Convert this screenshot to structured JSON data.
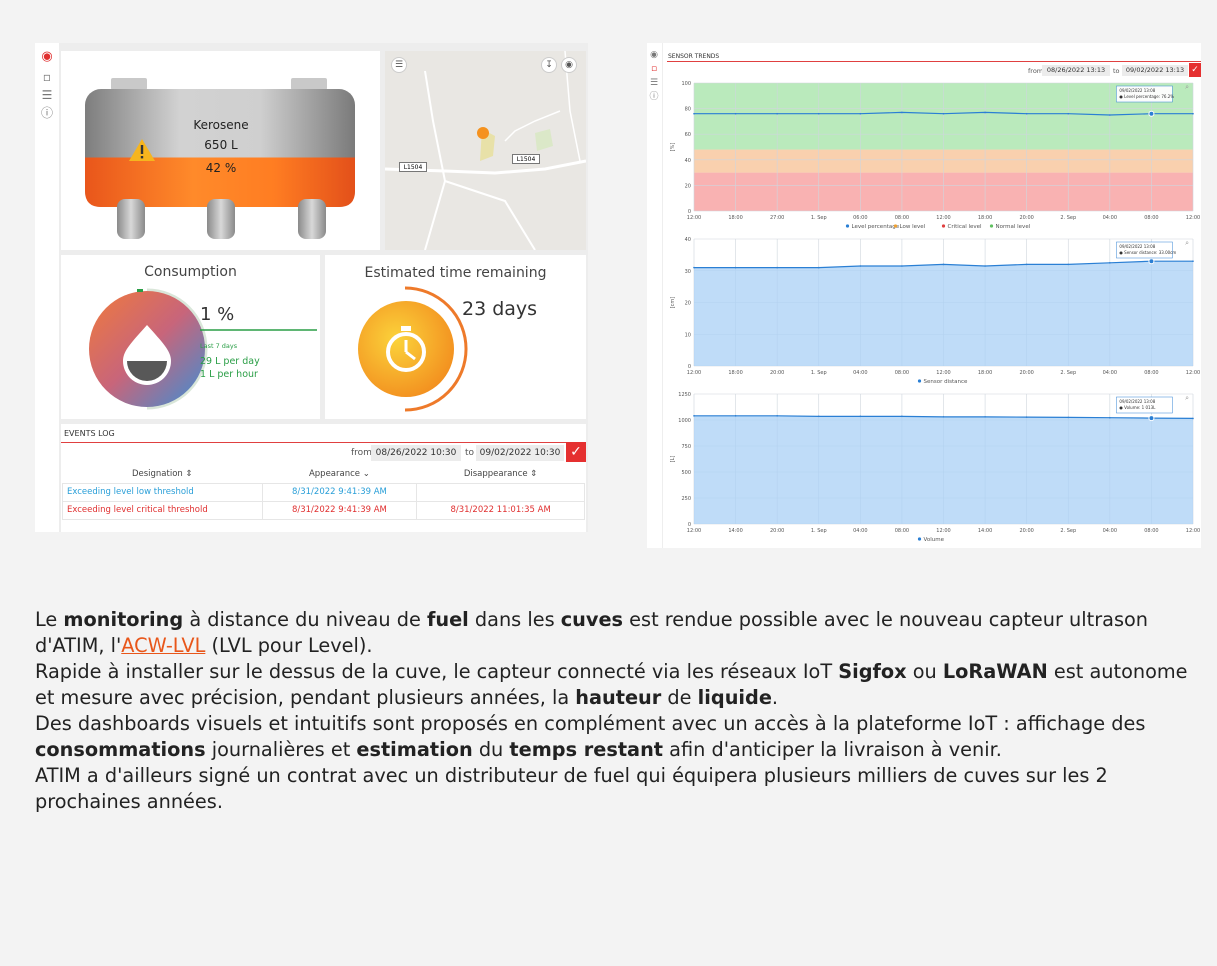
{
  "left_dashboard": {
    "rail": {
      "icons": [
        "alarm-icon",
        "bar-chart-icon",
        "settings-sliders-icon",
        "info-icon"
      ]
    },
    "tank": {
      "product": "Kerosene",
      "volume": "650 L",
      "level": "42 %",
      "level_fraction": 0.42,
      "warning": true
    },
    "map": {
      "road_labels": [
        "L1504",
        "L1504"
      ],
      "menu_icon": "menu-icon",
      "download_icon": "download-icon",
      "view_icon": "eye-icon"
    },
    "consumption": {
      "title": "Consumption",
      "percent": "1 %",
      "period": "Last 7 days",
      "per_day": "29 L per day",
      "per_hour": "1 L per hour"
    },
    "estimated_time": {
      "title": "Estimated time remaining",
      "value": "23 days"
    },
    "events_log": {
      "title": "EVENTS LOG",
      "from_label": "from",
      "from_value": "08/26/2022 10:30",
      "to_label": "to",
      "to_value": "09/02/2022 10:30",
      "columns": [
        "Designation ⇕",
        "Appearance ⌄",
        "Disappearance ⇕"
      ],
      "rows": [
        {
          "designation": "Exceeding level low threshold",
          "appearance": "8/31/2022 9:41:39 AM",
          "disappearance": "",
          "color": "#2a9fd8"
        },
        {
          "designation": "Exceeding level critical threshold",
          "appearance": "8/31/2022 9:41:39 AM",
          "disappearance": "8/31/2022 11:01:35 AM",
          "color": "#e03030"
        }
      ]
    }
  },
  "right_dashboard": {
    "title": "SENSOR TRENDS",
    "from_label": "from",
    "from_value": "08/26/2022 13:13",
    "to_label": "to",
    "to_value": "09/02/2022 13:13"
  },
  "chart_data": [
    {
      "type": "line",
      "ylabel": "[%]",
      "ylim": [
        0,
        100
      ],
      "yticks": [
        "0",
        "20",
        "40",
        "60",
        "80",
        "100"
      ],
      "x": [
        "12:00",
        "18:00",
        "27:00",
        "1. Sep",
        "06:00",
        "08:00",
        "12:00",
        "18:00",
        "20:00",
        "2. Sep",
        "04:00",
        "08:00",
        "12:00"
      ],
      "series": [
        {
          "name": "Level percentage",
          "values": [
            76,
            76,
            76,
            76,
            76,
            77,
            76,
            77,
            76,
            76,
            75,
            76,
            76
          ]
        }
      ],
      "bands": [
        {
          "name": "Critical level",
          "from": 0,
          "to": 30,
          "color": "#f8a5a5"
        },
        {
          "name": "Low level",
          "from": 30,
          "to": 48,
          "color": "#f8c8a0"
        },
        {
          "name": "Normal level",
          "from": 48,
          "to": 100,
          "color": "#aee6b0"
        }
      ],
      "legend": [
        "Level percentage",
        "Low level",
        "Critical level",
        "Normal level"
      ],
      "legend_colors": [
        "#2a7fd4",
        "#f0a030",
        "#e04040",
        "#60c060"
      ],
      "tooltip": [
        "09/02/2022 13:08",
        "● Level percentage: 76.2%"
      ]
    },
    {
      "type": "area",
      "ylabel": "[cm]",
      "ylim": [
        0,
        40
      ],
      "yticks": [
        "0",
        "10",
        "20",
        "30",
        "40"
      ],
      "x": [
        "12:00",
        "18:00",
        "20:00",
        "1. Sep",
        "04:00",
        "08:00",
        "12:00",
        "18:00",
        "20:00",
        "2. Sep",
        "04:00",
        "08:00",
        "12:00"
      ],
      "series": [
        {
          "name": "Sensor distance",
          "values": [
            31,
            31,
            31,
            31,
            31.5,
            31.5,
            32,
            31.5,
            32,
            32,
            32.5,
            33,
            33
          ]
        }
      ],
      "legend": [
        "Sensor distance"
      ],
      "tooltip": [
        "09/02/2022 13:08",
        "● Sensor distance: 33.00cm"
      ]
    },
    {
      "type": "area",
      "ylabel": "[L]",
      "ylim": [
        0,
        1250
      ],
      "yticks": [
        "0",
        "250",
        "500",
        "750",
        "1000",
        "1250"
      ],
      "x": [
        "12:00",
        "14:00",
        "20:00",
        "1. Sep",
        "04:00",
        "08:00",
        "12:00",
        "14:00",
        "20:00",
        "2. Sep",
        "04:00",
        "08:00",
        "12:00"
      ],
      "series": [
        {
          "name": "Volume",
          "values": [
            1040,
            1040,
            1040,
            1035,
            1035,
            1035,
            1030,
            1030,
            1028,
            1025,
            1022,
            1018,
            1015
          ]
        }
      ],
      "legend": [
        "Volume"
      ],
      "tooltip": [
        "09/02/2022 13:08",
        "● Volume: 1 013L"
      ]
    }
  ],
  "article": {
    "p1_a": "Le ",
    "p1_b": "monitoring",
    "p1_c": " à distance du niveau de ",
    "p1_d": "fuel",
    "p1_e": " dans les ",
    "p1_f": "cuves",
    "p1_g": " est rendue possible avec le nouveau capteur ultrason d'ATIM, l'",
    "p1_link": "ACW-LVL",
    "p1_h": " (LVL pour Level).",
    "p2_a": "Rapide à installer sur le dessus de la cuve, le capteur connecté via les réseaux IoT ",
    "p2_b": "Sigfox",
    "p2_c": " ou ",
    "p2_d": "LoRaWAN",
    "p2_e": " est autonome et mesure avec précision, pendant plusieurs années, la ",
    "p2_f": "hauteur",
    "p2_g": " de ",
    "p2_h": "liquide",
    "p2_i": ".",
    "p3_a": "Des dashboards visuels et intuitifs sont proposés en complément avec un accès à la plateforme IoT : affichage des ",
    "p3_b": "consommations",
    "p3_c": " journalières et ",
    "p3_d": "estimation",
    "p3_e": " du ",
    "p3_f": "temps restant",
    "p3_g": " afin d'anticiper la livraison à venir.",
    "p4": "ATIM a d'ailleurs signé un contrat avec un distributeur de fuel qui équipera plusieurs milliers de cuves sur les 2 prochaines années."
  }
}
